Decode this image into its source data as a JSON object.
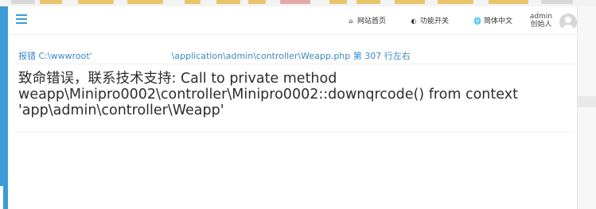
{
  "header": {
    "nav": [
      {
        "icon": "home-icon",
        "label": "网站首页"
      },
      {
        "icon": "toggle-icon",
        "label": "功能开关"
      },
      {
        "icon": "globe-icon",
        "label": "简体中文"
      }
    ],
    "user": {
      "name": "admin",
      "role": "创始人"
    }
  },
  "error": {
    "location_prefix": "报错 C:\\wwwroot'",
    "location_suffix": "\\application\\admin\\controller\\Weapp.php 第 307 行左右",
    "message_line1": "致命错误，联系技术支持: Call to private method",
    "message_line2": "weapp\\Minipro0002\\controller\\Minipro0002::downqrcode() from context",
    "message_line3": "'app\\admin\\controller\\Weapp'"
  },
  "colors": {
    "accent": "#3a9bd8",
    "link": "#3a8ac4",
    "text": "#2d2d2d"
  }
}
